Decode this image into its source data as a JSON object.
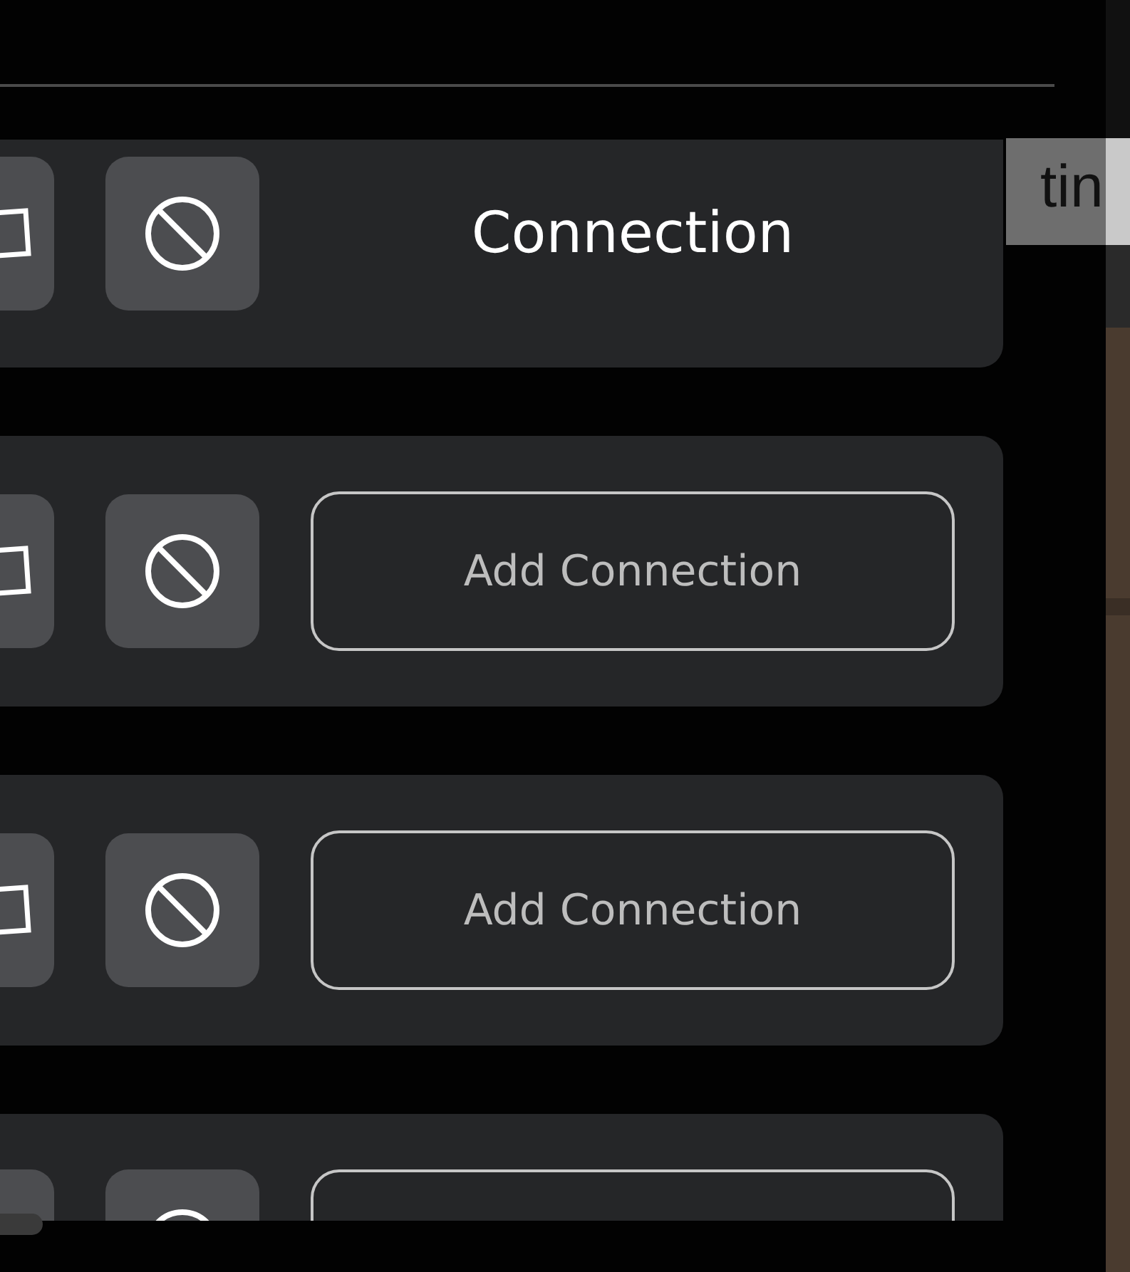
{
  "background_text": "tin",
  "cards": [
    {
      "kind": "label",
      "text": "Connection"
    },
    {
      "kind": "button",
      "text": "Add Connection"
    },
    {
      "kind": "button",
      "text": "Add Connection"
    },
    {
      "kind": "button"
    }
  ]
}
